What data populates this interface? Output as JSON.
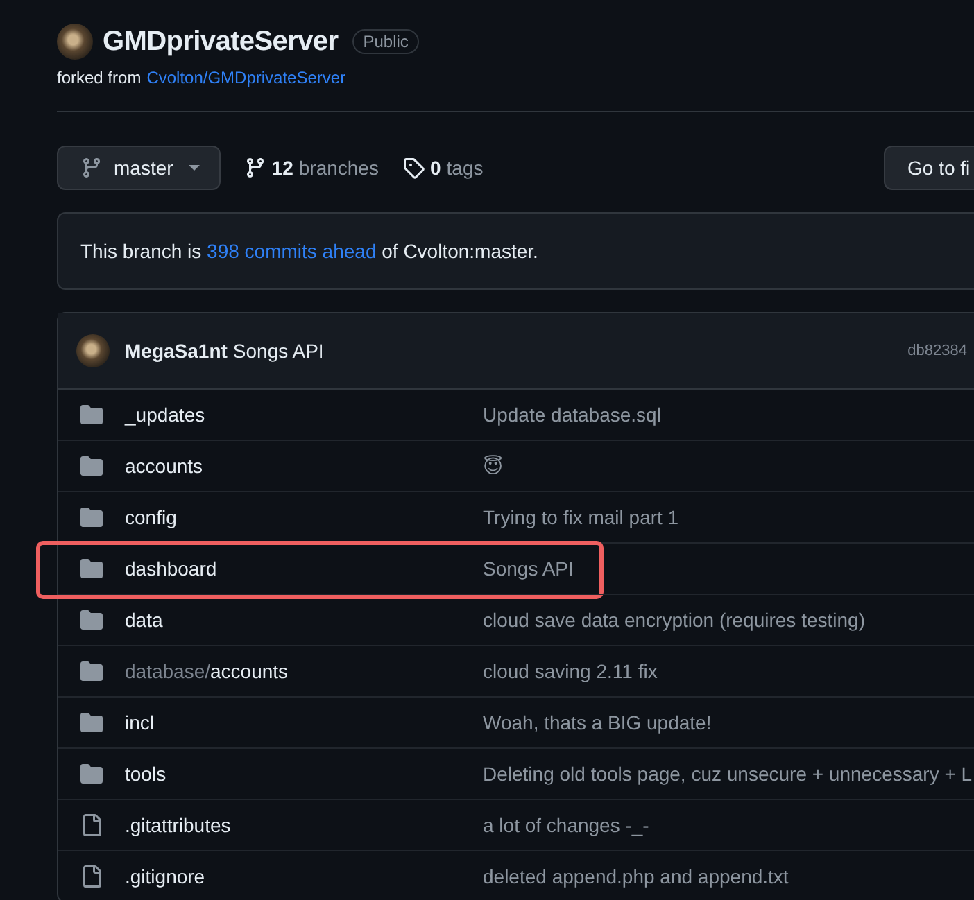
{
  "repo": {
    "name": "GMDprivateServer",
    "visibility": "Public",
    "fork_label": "forked from",
    "fork_source": "Cvolton/GMDprivateServer"
  },
  "toolbar": {
    "branch": "master",
    "branches_count": "12",
    "branches_label": "branches",
    "tags_count": "0",
    "tags_label": "tags",
    "go_to_file": "Go to fi"
  },
  "branch_status": {
    "before": "This branch is",
    "link": "398 commits ahead",
    "after": "of Cvolton:master."
  },
  "latest_commit": {
    "author": "MegaSa1nt",
    "message": "Songs API",
    "sha": "db82384"
  },
  "files": [
    {
      "kind": "dir",
      "name": "_updates",
      "message": "Update database.sql",
      "highlighted": false
    },
    {
      "kind": "dir",
      "name": "accounts",
      "message": "😇",
      "highlighted": false
    },
    {
      "kind": "dir",
      "name": "config",
      "message": "Trying to fix mail part 1",
      "highlighted": false
    },
    {
      "kind": "dir",
      "name": "dashboard",
      "message": "Songs API",
      "highlighted": true
    },
    {
      "kind": "dir",
      "name": "data",
      "message": "cloud save data encryption (requires testing)",
      "highlighted": false
    },
    {
      "kind": "dir",
      "path_prefix": "database/",
      "name": "accounts",
      "message": "cloud saving 2.11 fix",
      "highlighted": false
    },
    {
      "kind": "dir",
      "name": "incl",
      "message": "Woah, thats a BIG update!",
      "highlighted": false
    },
    {
      "kind": "dir",
      "name": "tools",
      "message": "Deleting old tools page, cuz unsecure + unnecessary + L",
      "highlighted": false
    },
    {
      "kind": "file",
      "name": ".gitattributes",
      "message": "a lot of changes -_-",
      "highlighted": false
    },
    {
      "kind": "file",
      "name": ".gitignore",
      "message": "deleted append.php and append.txt",
      "highlighted": false
    }
  ]
}
